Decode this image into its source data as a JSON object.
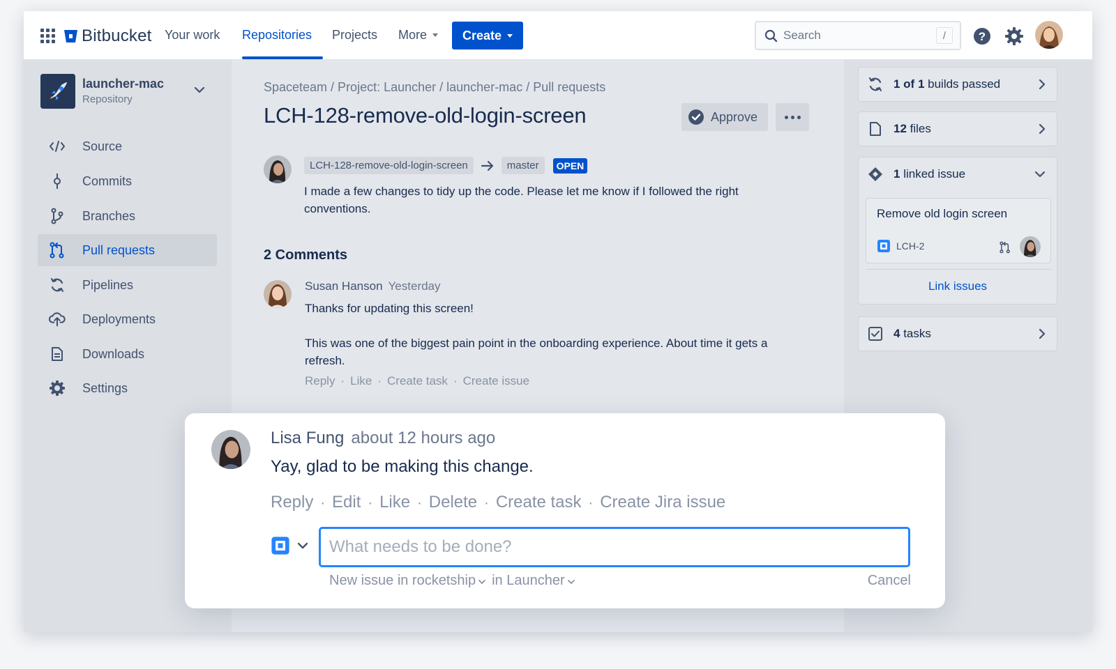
{
  "topnav": {
    "brand": "Bitbucket",
    "links": [
      "Your work",
      "Repositories",
      "Projects",
      "More"
    ],
    "active_link": "Repositories",
    "create_label": "Create",
    "search_placeholder": "Search",
    "search_shortcut": "/"
  },
  "sidebar": {
    "repo_name": "launcher-mac",
    "repo_type": "Repository",
    "items": [
      {
        "label": "Source",
        "icon": "code-icon"
      },
      {
        "label": "Commits",
        "icon": "commit-icon"
      },
      {
        "label": "Branches",
        "icon": "branch-icon"
      },
      {
        "label": "Pull requests",
        "icon": "pull-request-icon",
        "active": true
      },
      {
        "label": "Pipelines",
        "icon": "pipeline-icon"
      },
      {
        "label": "Deployments",
        "icon": "cloud-upload-icon"
      },
      {
        "label": "Downloads",
        "icon": "document-icon"
      },
      {
        "label": "Settings",
        "icon": "gear-icon"
      }
    ]
  },
  "main": {
    "breadcrumb": "Spaceteam / Project: Launcher / launcher-mac / Pull requests",
    "title": "LCH-128-remove-old-login-screen",
    "approve_label": "Approve",
    "source_branch": "LCH-128-remove-old-login-screen",
    "target_branch": "master",
    "status": "OPEN",
    "description": "I made a few changes to tidy up the code. Please let me know if I followed the right conventions.",
    "comments_heading": "2 Comments",
    "comment": {
      "author": "Susan Hanson",
      "time": "Yesterday",
      "line1": "Thanks for updating this screen!",
      "line2": "This was one of the biggest pain point in the onboarding experience. About time it gets a refresh.",
      "actions": [
        "Reply",
        "Like",
        "Create task",
        "Create issue"
      ]
    }
  },
  "rpanel": {
    "builds": {
      "count": "1 of 1",
      "text": "builds passed"
    },
    "files": {
      "count": "12",
      "text": "files"
    },
    "linked": {
      "count": "1",
      "text": "linked issue"
    },
    "issue_title": "Remove old login screen",
    "issue_key": "LCH-2",
    "link_issues": "Link issues",
    "tasks": {
      "count": "4",
      "text": "tasks"
    }
  },
  "popup": {
    "author": "Lisa Fung",
    "time": "about 12 hours ago",
    "body": "Yay, glad to be making this change.",
    "actions": [
      "Reply",
      "Edit",
      "Like",
      "Delete",
      "Create task",
      "Create Jira issue"
    ],
    "input_placeholder": "What needs to be done?",
    "meta_project": "New issue in rocketship",
    "meta_in": "in Launcher",
    "cancel": "Cancel"
  },
  "colors": {
    "brand": "#0052cc",
    "sidebar": "#dcdfe4",
    "focus": "#2684ff"
  }
}
